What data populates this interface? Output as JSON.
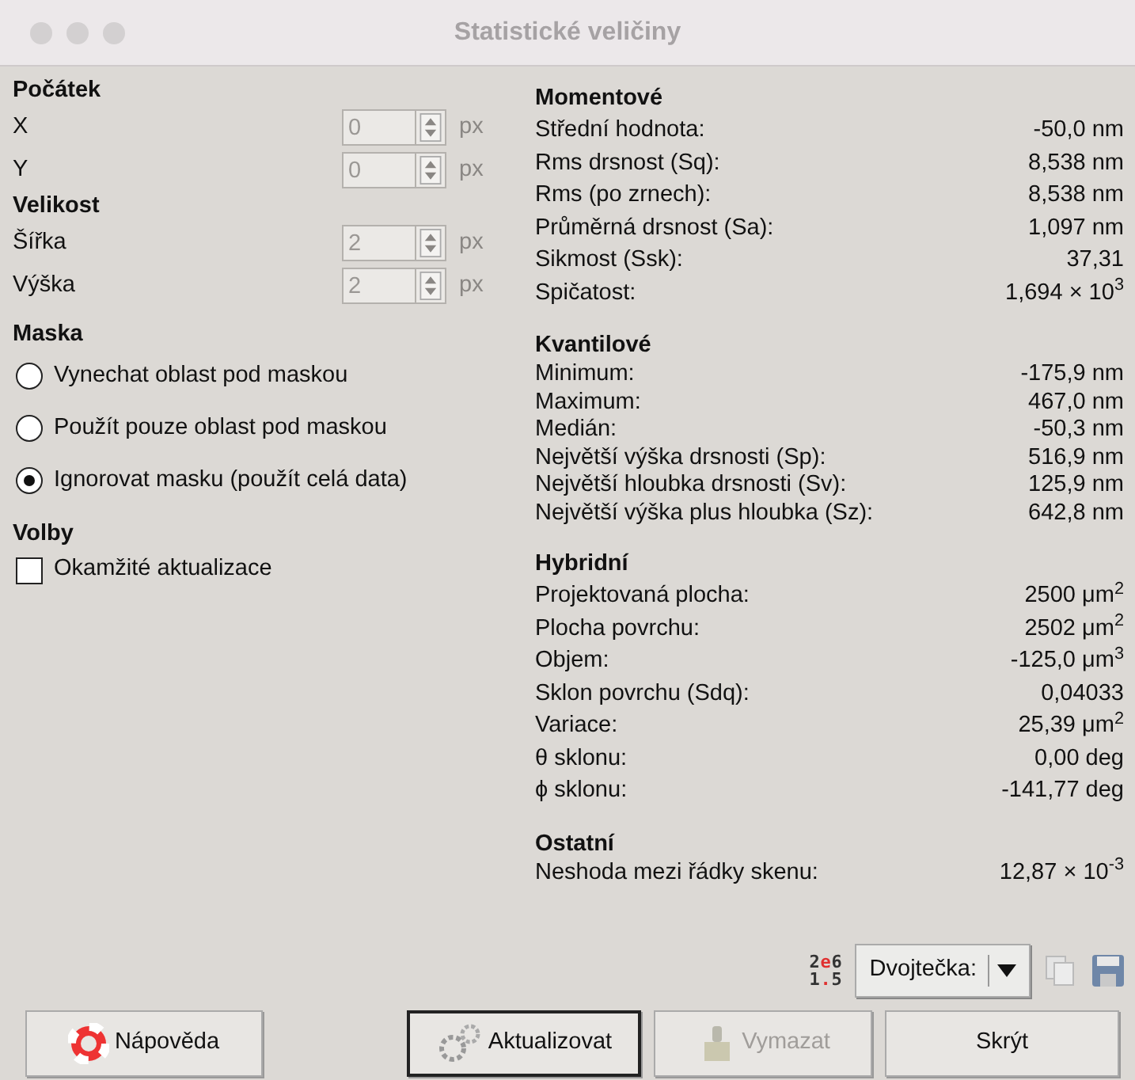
{
  "window": {
    "title": "Statistické veličiny"
  },
  "left": {
    "sections": [
      {
        "heading": "Počátek",
        "kind": "spins",
        "fields": [
          {
            "label": "X",
            "value": "0",
            "unit": "px",
            "disabled": true
          },
          {
            "label": "Y",
            "value": "0",
            "unit": "px",
            "disabled": true
          }
        ]
      },
      {
        "heading": "Velikost",
        "kind": "spins",
        "fields": [
          {
            "label": "Šířka",
            "value": "2",
            "unit": "px",
            "disabled": true
          },
          {
            "label": "Výška",
            "value": "2",
            "unit": "px",
            "disabled": true
          }
        ]
      },
      {
        "heading": "Maska",
        "kind": "radios",
        "options": [
          {
            "label": "Vynechat oblast pod maskou",
            "selected": false
          },
          {
            "label": "Použít pouze oblast pod maskou",
            "selected": false
          },
          {
            "label": "Ignorovat masku (použít celá data)",
            "selected": true
          }
        ]
      },
      {
        "heading": "Volby",
        "kind": "checks",
        "options": [
          {
            "label": "Okamžité aktualizace",
            "checked": false
          }
        ]
      }
    ]
  },
  "right": {
    "groups": [
      {
        "heading": "Momentové",
        "rows": [
          {
            "label": "Střední hodnota:",
            "value": "-50,0 nm"
          },
          {
            "label": "Rms drsnost (Sq):",
            "value": "8,538 nm"
          },
          {
            "label": "Rms (po zrnech):",
            "value": "8,538 nm"
          },
          {
            "label": "Průměrná drsnost (Sa):",
            "value": "1,097 nm"
          },
          {
            "label": "Sikmost (Ssk):",
            "value": "37,31"
          },
          {
            "label": "Spičatost:",
            "value": "1,694 × 10$^{3}$"
          }
        ]
      },
      {
        "heading": "Kvantilové",
        "rows": [
          {
            "label": "Minimum:",
            "value": "-175,9 nm"
          },
          {
            "label": "Maximum:",
            "value": "467,0 nm"
          },
          {
            "label": "Medián:",
            "value": "-50,3 nm"
          },
          {
            "label": "Největší výška drsnosti (Sp):",
            "value": "516,9 nm"
          },
          {
            "label": "Největší hloubka drsnosti (Sv):",
            "value": "125,9 nm"
          },
          {
            "label": "Největší výška plus hloubka (Sz):",
            "value": "642,8 nm"
          }
        ]
      },
      {
        "heading": "Hybridní",
        "rows": [
          {
            "label": "Projektovaná plocha:",
            "value": "2500 μm$^{2}$"
          },
          {
            "label": "Plocha povrchu:",
            "value": "2502 μm$^{2}$"
          },
          {
            "label": "Objem:",
            "value": "-125,0 μm$^{3}$"
          },
          {
            "label": "Sklon povrchu (Sdq):",
            "value": "0,04033"
          },
          {
            "label": "Variace:",
            "value": "25,39 μm$^{2}$"
          },
          {
            "label": "θ sklonu:",
            "value": "0,00 deg"
          },
          {
            "label": "ϕ sklonu:",
            "value": "-141,77 deg"
          }
        ]
      },
      {
        "heading": "Ostatní",
        "rows": [
          {
            "label": "Neshoda mezi řádky skenu:",
            "value": "12,87 × 10$^{-3}$"
          }
        ]
      }
    ]
  },
  "toolbar": {
    "format_glyph": [
      "2",
      "e",
      "6",
      "1",
      ".",
      "5"
    ],
    "separator_select": "Dvojtečka:"
  },
  "buttons": [
    {
      "label": "Nápověda",
      "kind": "help",
      "disabled": false,
      "default": false
    },
    {
      "label": "Aktualizovat",
      "kind": "update",
      "disabled": false,
      "default": true
    },
    {
      "label": "Vymazat",
      "kind": "clear",
      "disabled": true,
      "default": false
    },
    {
      "label": "Skrýt",
      "kind": "hide",
      "disabled": false,
      "default": false
    }
  ]
}
